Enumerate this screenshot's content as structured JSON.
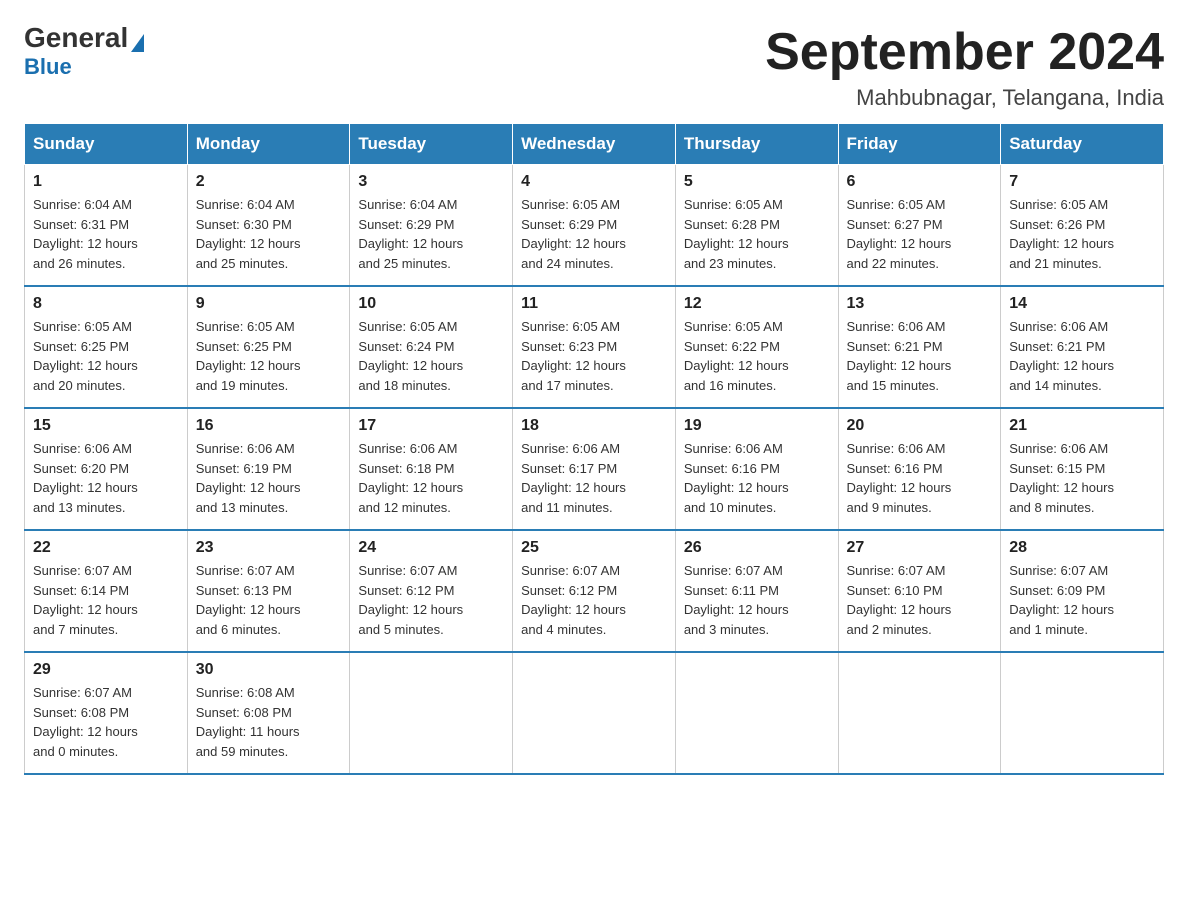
{
  "header": {
    "logo_general": "General",
    "logo_blue": "Blue",
    "title": "September 2024",
    "subtitle": "Mahbubnagar, Telangana, India"
  },
  "weekdays": [
    "Sunday",
    "Monday",
    "Tuesday",
    "Wednesday",
    "Thursday",
    "Friday",
    "Saturday"
  ],
  "weeks": [
    [
      {
        "day": "1",
        "sunrise": "6:04 AM",
        "sunset": "6:31 PM",
        "daylight": "12 hours and 26 minutes."
      },
      {
        "day": "2",
        "sunrise": "6:04 AM",
        "sunset": "6:30 PM",
        "daylight": "12 hours and 25 minutes."
      },
      {
        "day": "3",
        "sunrise": "6:04 AM",
        "sunset": "6:29 PM",
        "daylight": "12 hours and 25 minutes."
      },
      {
        "day": "4",
        "sunrise": "6:05 AM",
        "sunset": "6:29 PM",
        "daylight": "12 hours and 24 minutes."
      },
      {
        "day": "5",
        "sunrise": "6:05 AM",
        "sunset": "6:28 PM",
        "daylight": "12 hours and 23 minutes."
      },
      {
        "day": "6",
        "sunrise": "6:05 AM",
        "sunset": "6:27 PM",
        "daylight": "12 hours and 22 minutes."
      },
      {
        "day": "7",
        "sunrise": "6:05 AM",
        "sunset": "6:26 PM",
        "daylight": "12 hours and 21 minutes."
      }
    ],
    [
      {
        "day": "8",
        "sunrise": "6:05 AM",
        "sunset": "6:25 PM",
        "daylight": "12 hours and 20 minutes."
      },
      {
        "day": "9",
        "sunrise": "6:05 AM",
        "sunset": "6:25 PM",
        "daylight": "12 hours and 19 minutes."
      },
      {
        "day": "10",
        "sunrise": "6:05 AM",
        "sunset": "6:24 PM",
        "daylight": "12 hours and 18 minutes."
      },
      {
        "day": "11",
        "sunrise": "6:05 AM",
        "sunset": "6:23 PM",
        "daylight": "12 hours and 17 minutes."
      },
      {
        "day": "12",
        "sunrise": "6:05 AM",
        "sunset": "6:22 PM",
        "daylight": "12 hours and 16 minutes."
      },
      {
        "day": "13",
        "sunrise": "6:06 AM",
        "sunset": "6:21 PM",
        "daylight": "12 hours and 15 minutes."
      },
      {
        "day": "14",
        "sunrise": "6:06 AM",
        "sunset": "6:21 PM",
        "daylight": "12 hours and 14 minutes."
      }
    ],
    [
      {
        "day": "15",
        "sunrise": "6:06 AM",
        "sunset": "6:20 PM",
        "daylight": "12 hours and 13 minutes."
      },
      {
        "day": "16",
        "sunrise": "6:06 AM",
        "sunset": "6:19 PM",
        "daylight": "12 hours and 13 minutes."
      },
      {
        "day": "17",
        "sunrise": "6:06 AM",
        "sunset": "6:18 PM",
        "daylight": "12 hours and 12 minutes."
      },
      {
        "day": "18",
        "sunrise": "6:06 AM",
        "sunset": "6:17 PM",
        "daylight": "12 hours and 11 minutes."
      },
      {
        "day": "19",
        "sunrise": "6:06 AM",
        "sunset": "6:16 PM",
        "daylight": "12 hours and 10 minutes."
      },
      {
        "day": "20",
        "sunrise": "6:06 AM",
        "sunset": "6:16 PM",
        "daylight": "12 hours and 9 minutes."
      },
      {
        "day": "21",
        "sunrise": "6:06 AM",
        "sunset": "6:15 PM",
        "daylight": "12 hours and 8 minutes."
      }
    ],
    [
      {
        "day": "22",
        "sunrise": "6:07 AM",
        "sunset": "6:14 PM",
        "daylight": "12 hours and 7 minutes."
      },
      {
        "day": "23",
        "sunrise": "6:07 AM",
        "sunset": "6:13 PM",
        "daylight": "12 hours and 6 minutes."
      },
      {
        "day": "24",
        "sunrise": "6:07 AM",
        "sunset": "6:12 PM",
        "daylight": "12 hours and 5 minutes."
      },
      {
        "day": "25",
        "sunrise": "6:07 AM",
        "sunset": "6:12 PM",
        "daylight": "12 hours and 4 minutes."
      },
      {
        "day": "26",
        "sunrise": "6:07 AM",
        "sunset": "6:11 PM",
        "daylight": "12 hours and 3 minutes."
      },
      {
        "day": "27",
        "sunrise": "6:07 AM",
        "sunset": "6:10 PM",
        "daylight": "12 hours and 2 minutes."
      },
      {
        "day": "28",
        "sunrise": "6:07 AM",
        "sunset": "6:09 PM",
        "daylight": "12 hours and 1 minute."
      }
    ],
    [
      {
        "day": "29",
        "sunrise": "6:07 AM",
        "sunset": "6:08 PM",
        "daylight": "12 hours and 0 minutes."
      },
      {
        "day": "30",
        "sunrise": "6:08 AM",
        "sunset": "6:08 PM",
        "daylight": "11 hours and 59 minutes."
      },
      null,
      null,
      null,
      null,
      null
    ]
  ],
  "labels": {
    "sunrise": "Sunrise:",
    "sunset": "Sunset:",
    "daylight": "Daylight:"
  }
}
